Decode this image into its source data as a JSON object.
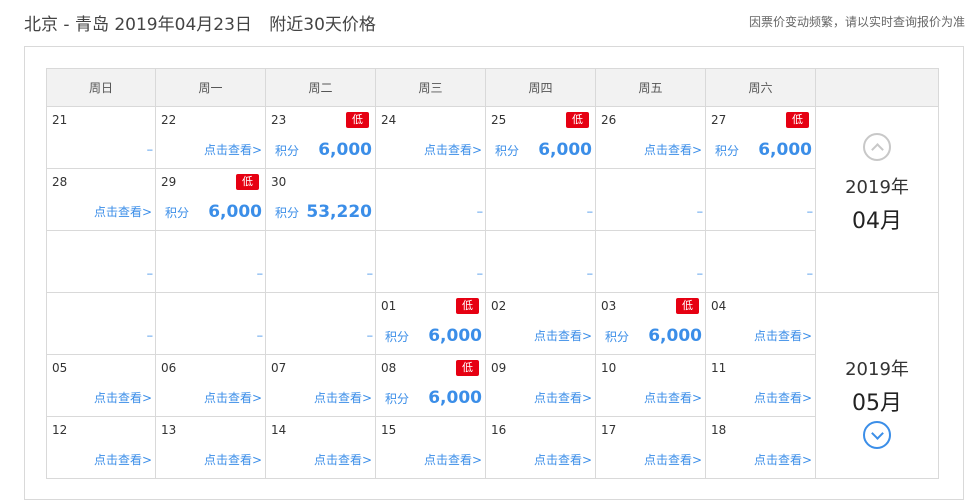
{
  "header": {
    "route": "北京 - 青岛",
    "date": "2019年04月23日",
    "subtitle": "附近30天价格",
    "note": "因票价变动频繁，请以实时查询报价为准"
  },
  "weekdays": [
    "周日",
    "周一",
    "周二",
    "周三",
    "周四",
    "周五",
    "周六"
  ],
  "labels": {
    "view": "点击查看>",
    "points": "积分",
    "low": "低",
    "none": "--"
  },
  "side": {
    "prev_year": "2019年",
    "prev_month": "04月",
    "next_year": "2019年",
    "next_month": "05月"
  },
  "rows": [
    [
      {
        "day": "21",
        "type": "none"
      },
      {
        "day": "22",
        "type": "view"
      },
      {
        "day": "23",
        "type": "price",
        "price": "6,000",
        "low": true
      },
      {
        "day": "24",
        "type": "view"
      },
      {
        "day": "25",
        "type": "price",
        "price": "6,000",
        "low": true
      },
      {
        "day": "26",
        "type": "view"
      },
      {
        "day": "27",
        "type": "price",
        "price": "6,000",
        "low": true
      }
    ],
    [
      {
        "day": "28",
        "type": "view"
      },
      {
        "day": "29",
        "type": "price",
        "price": "6,000",
        "low": true
      },
      {
        "day": "30",
        "type": "price",
        "price": "53,220"
      },
      {
        "day": "",
        "type": "none"
      },
      {
        "day": "",
        "type": "none"
      },
      {
        "day": "",
        "type": "none"
      },
      {
        "day": "",
        "type": "none"
      }
    ],
    [
      {
        "day": "",
        "type": "none"
      },
      {
        "day": "",
        "type": "none"
      },
      {
        "day": "",
        "type": "none"
      },
      {
        "day": "",
        "type": "none"
      },
      {
        "day": "",
        "type": "none"
      },
      {
        "day": "",
        "type": "none"
      },
      {
        "day": "",
        "type": "none"
      }
    ],
    [
      {
        "day": "",
        "type": "none"
      },
      {
        "day": "",
        "type": "none"
      },
      {
        "day": "",
        "type": "none"
      },
      {
        "day": "01",
        "type": "price",
        "price": "6,000",
        "low": true
      },
      {
        "day": "02",
        "type": "view"
      },
      {
        "day": "03",
        "type": "price",
        "price": "6,000",
        "low": true
      },
      {
        "day": "04",
        "type": "view"
      }
    ],
    [
      {
        "day": "05",
        "type": "view"
      },
      {
        "day": "06",
        "type": "view"
      },
      {
        "day": "07",
        "type": "view"
      },
      {
        "day": "08",
        "type": "price",
        "price": "6,000",
        "low": true
      },
      {
        "day": "09",
        "type": "view"
      },
      {
        "day": "10",
        "type": "view"
      },
      {
        "day": "11",
        "type": "view"
      }
    ],
    [
      {
        "day": "12",
        "type": "view"
      },
      {
        "day": "13",
        "type": "view"
      },
      {
        "day": "14",
        "type": "view"
      },
      {
        "day": "15",
        "type": "view"
      },
      {
        "day": "16",
        "type": "view"
      },
      {
        "day": "17",
        "type": "view"
      },
      {
        "day": "18",
        "type": "view"
      }
    ]
  ]
}
